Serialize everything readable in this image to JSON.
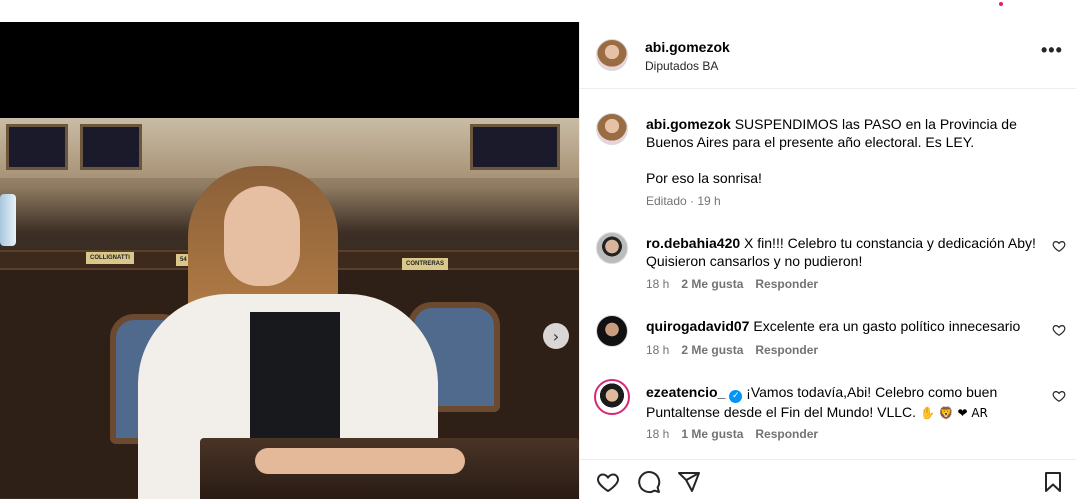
{
  "post": {
    "author": "abi.gomezok",
    "location": "Diputados BA",
    "caption": "SUSPENDIMOS las PASO en la Provincia de Buenos Aires para el presente año electoral. Es LEY.",
    "caption_extra": "Por eso la sonrisa!",
    "edited_label": "Editado",
    "time": "19 h",
    "photo_alt": "Legisladora sonriendo en su banca de la Cámara",
    "nameplates": [
      "COLLIGNATTI",
      "54",
      "CONTRERAS"
    ],
    "carousel": {
      "total": 2,
      "active": 1
    }
  },
  "comments": [
    {
      "user": "ro.debahia420",
      "text": "X fin!!! Celebro tu constancia y dedicación Aby! Quisieron cansarlos y no pudieron!",
      "time": "18 h",
      "likes": "2 Me gusta",
      "reply": "Responder"
    },
    {
      "user": "quirogadavid07",
      "text": "Excelente era un gasto político innecesario",
      "time": "18 h",
      "likes": "2 Me gusta",
      "reply": "Responder"
    },
    {
      "user": "ezeatencio_",
      "verified": true,
      "text": "¡Vamos todavía,Abi! Celebro como buen Puntaltense desde el Fin del Mundo! VLLC.",
      "emoji_tail": "✋ 🦁 ❤ AR",
      "time": "18 h",
      "likes": "1 Me gusta",
      "reply": "Responder"
    }
  ],
  "icons": {
    "more": "more-horizontal-icon",
    "like": "heart-icon",
    "comment": "comment-icon",
    "share": "share-icon",
    "save": "bookmark-icon",
    "next": "chevron-right-icon"
  },
  "colors": {
    "verified": "#0095f6",
    "muted": "#737373",
    "notification": "#e0245e"
  }
}
